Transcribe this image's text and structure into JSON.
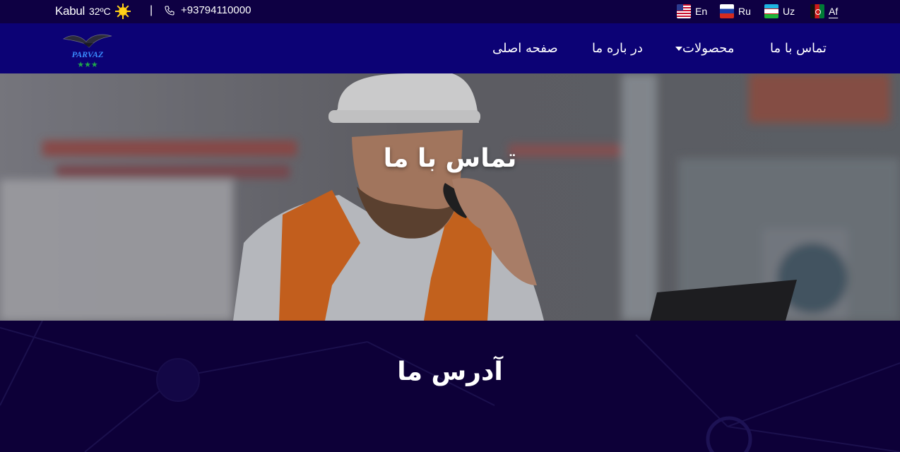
{
  "topbar": {
    "city": "Kabul",
    "temperature": "32ºC",
    "weather_icon": "sun-icon",
    "separator": "|",
    "phone": "+93794110000",
    "phone_icon": "phone-icon",
    "languages": [
      {
        "label": "En",
        "flag": "us-flag-icon"
      },
      {
        "label": "Ru",
        "flag": "russia-flag-icon"
      },
      {
        "label": "Uz",
        "flag": "uzbekistan-flag-icon"
      },
      {
        "label": "Af",
        "flag": "afghanistan-flag-icon",
        "active": true
      }
    ]
  },
  "navbar": {
    "logo_text": "PARVAZ",
    "items": [
      {
        "label": "تماس با ما"
      },
      {
        "label": "محصولات",
        "dropdown": true
      },
      {
        "label": "در باره ما"
      },
      {
        "label": "صفحه اصلی"
      }
    ]
  },
  "hero": {
    "title": "تماس با ما"
  },
  "address": {
    "title": "آدرس ما"
  },
  "colors": {
    "topbar_bg": "#0e0043",
    "navbar_bg": "#0c0275",
    "section_bg": "#0d0038",
    "logo_accent": "#1fa84a"
  }
}
